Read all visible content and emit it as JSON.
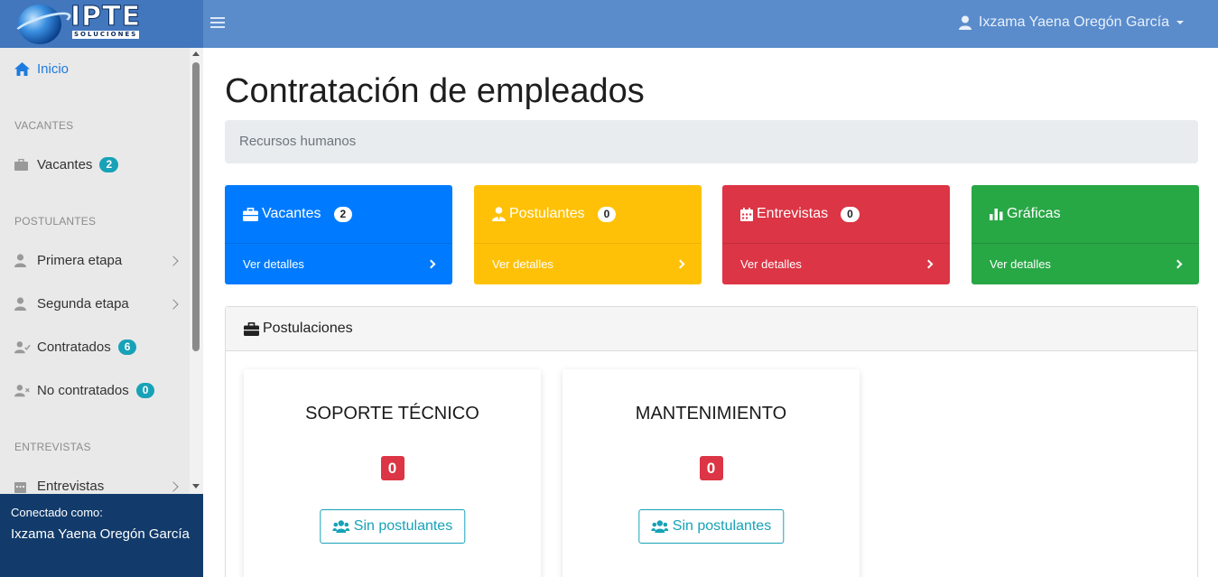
{
  "brand": {
    "logo_text": "IPTE",
    "logo_sub": "SOLUCIONES"
  },
  "header": {
    "user_name": "Ixzama Yaena Oregón García"
  },
  "sidebar": {
    "home": "Inicio",
    "section_vacantes": "VACANTES",
    "vacantes": {
      "label": "Vacantes",
      "count": "2"
    },
    "section_postulantes": "POSTULANTES",
    "primera": "Primera etapa",
    "segunda": "Segunda etapa",
    "contratados": {
      "label": "Contratados",
      "count": "6"
    },
    "no_contratados": {
      "label": "No contratados",
      "count": "0"
    },
    "section_entrevistas": "ENTREVISTAS",
    "entrevistas": "Entrevistas"
  },
  "connected": {
    "label": "Conectado como:",
    "name": "Ixzama Yaena Oregón García"
  },
  "page": {
    "title": "Contratación de empleados",
    "breadcrumb": "Recursos humanos"
  },
  "stats": [
    {
      "label": "Vacantes",
      "count": "2",
      "link": "Ver detalles",
      "color": "#007bff"
    },
    {
      "label": "Postulantes",
      "count": "0",
      "link": "Ver detalles",
      "color": "#ffc107"
    },
    {
      "label": "Entrevistas",
      "count": "0",
      "link": "Ver detalles",
      "color": "#dc3545"
    },
    {
      "label": "Gráficas",
      "link": "Ver detalles",
      "color": "#28a745"
    }
  ],
  "postulaciones": {
    "title": "Postulaciones",
    "jobs": [
      {
        "title": "SOPORTE TÉCNICO",
        "count": "0",
        "button": "Sin postulantes"
      },
      {
        "title": "MANTENIMIENTO",
        "count": "0",
        "button": "Sin postulantes"
      }
    ]
  }
}
